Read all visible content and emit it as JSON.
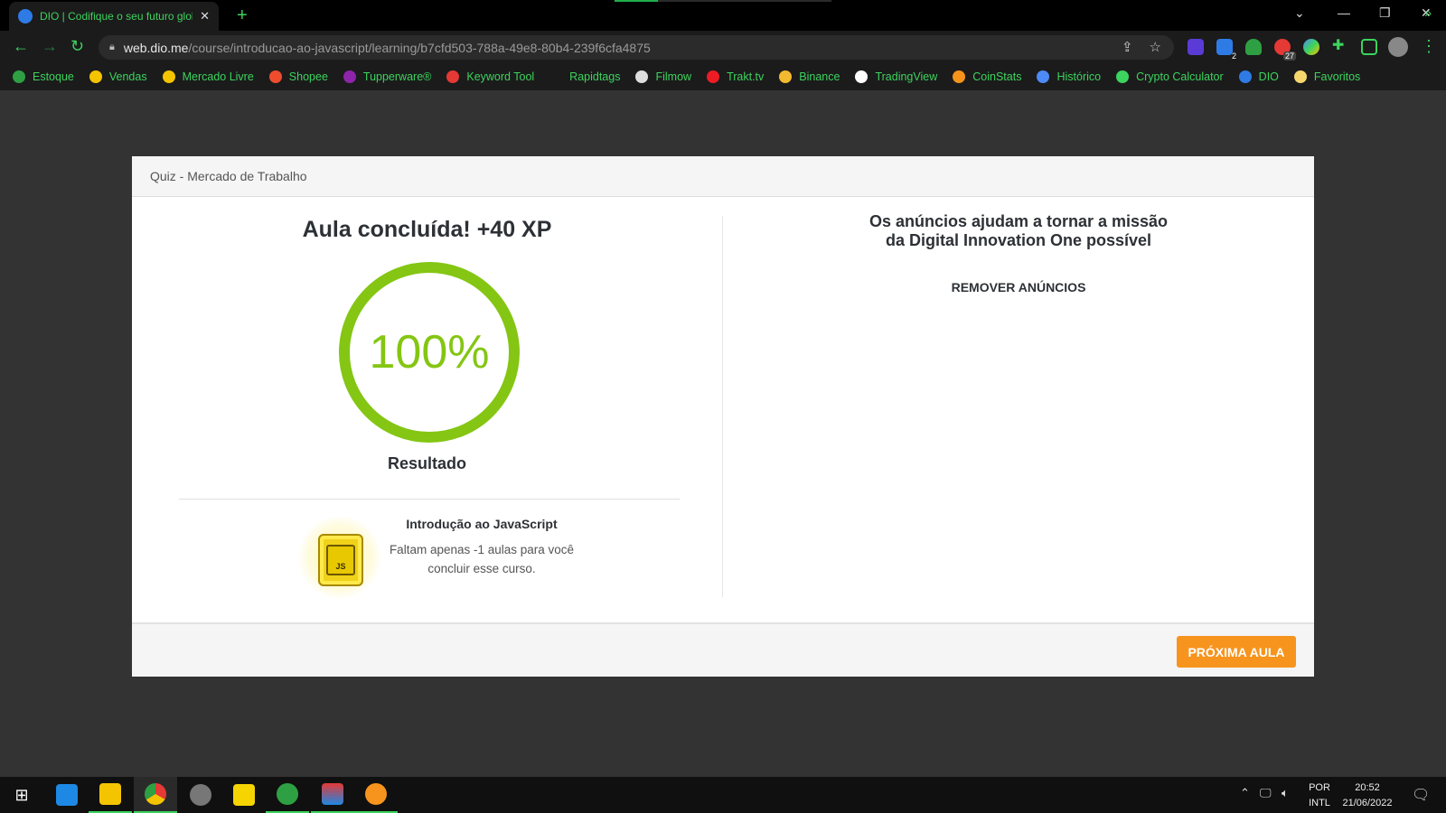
{
  "browser": {
    "tab_title": "DIO | Codifique o seu futuro global",
    "tab_close": "✕",
    "new_tab": "+",
    "url_host": "web.dio.me",
    "url_path": "/course/introducao-ao-javascript/learning/b7cfd503-788a-49e8-80b4-239f6cfa4875",
    "extension_badges": [
      "2",
      "27"
    ],
    "bookmarks": [
      {
        "label": "Estoque",
        "color": "#2ea043"
      },
      {
        "label": "Vendas",
        "color": "#f5c400"
      },
      {
        "label": "Mercado Livre",
        "color": "#f5c400"
      },
      {
        "label": "Shopee",
        "color": "#ee4d2d"
      },
      {
        "label": "Tupperware®",
        "color": "#8e24aa"
      },
      {
        "label": "Keyword Tool",
        "color": "#e53935"
      },
      {
        "label": "Rapidtags",
        "color": "#1b1b1b"
      },
      {
        "label": "Filmow",
        "color": "#dddddd"
      },
      {
        "label": "Trakt.tv",
        "color": "#ed1c24"
      },
      {
        "label": "Binance",
        "color": "#f3ba2f"
      },
      {
        "label": "TradingView",
        "color": "#ffffff"
      },
      {
        "label": "CoinStats",
        "color": "#f7931a"
      },
      {
        "label": "Histórico",
        "color": "#4c8bf5"
      },
      {
        "label": "Crypto Calculator",
        "color": "#3cd35e"
      },
      {
        "label": "DIO",
        "color": "#2e7be5"
      },
      {
        "label": "Favoritos",
        "color": "#f5d76e"
      }
    ],
    "bookmarks_more": "»"
  },
  "page": {
    "header": "Quiz - Mercado de Trabalho",
    "completion_title": "Aula concluída! +40 XP",
    "progress_percent": 100,
    "progress_label": "100%",
    "result_label": "Resultado",
    "course": {
      "badge_text": "JS",
      "name": "Introdução ao JavaScript",
      "remaining": "Faltam apenas -1 aulas para você concluir esse curso."
    },
    "ads": {
      "title": "Os anúncios ajudam a tornar a missão da Digital Innovation One possível",
      "remove_label": "REMOVER ANÚNCIOS"
    },
    "next_button": "PRÓXIMA AULA"
  },
  "taskbar": {
    "language_top": "POR",
    "language_bottom": "INTL",
    "time": "20:52",
    "date": "21/06/2022"
  },
  "colors": {
    "accent_green": "#84c613",
    "button_orange": "#f7941d",
    "chrome_green": "#3cd35e"
  }
}
